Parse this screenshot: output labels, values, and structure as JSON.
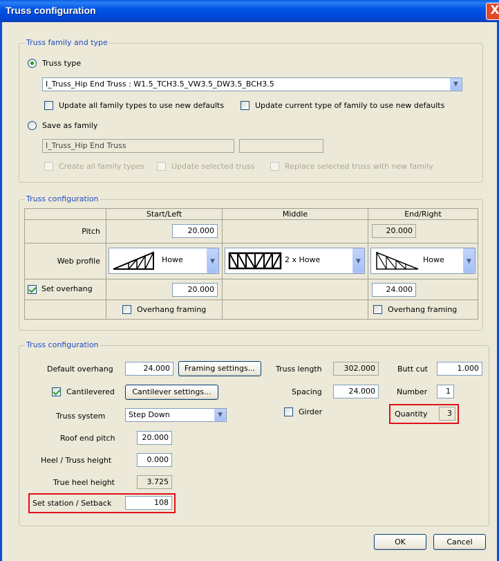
{
  "window": {
    "title": "Truss configuration",
    "close_glyph": "X"
  },
  "family_group": {
    "legend": "Truss family and type",
    "truss_type_label": "Truss type",
    "truss_type_selected": true,
    "truss_type_value": "I_Truss_Hip End Truss : W1.5_TCH3.5_VW3.5_DW3.5_BCH3.5",
    "update_all_label": "Update all family types to use new defaults",
    "update_current_label": "Update current type of family to use new defaults",
    "save_as_family_label": "Save as family",
    "family_name_value": "I_Truss_Hip End Truss",
    "family_type_value": "",
    "create_all_label": "Create all family types",
    "update_selected_label": "Update selected truss",
    "replace_selected_label": "Replace selected truss with new family"
  },
  "config_table": {
    "legend": "Truss configuration",
    "headers": [
      "Start/Left",
      "Middle",
      "End/Right"
    ],
    "pitch_label": "Pitch",
    "pitch_start": "20.000",
    "pitch_end": "20.000",
    "web_profile_label": "Web profile",
    "web_start": "Howe",
    "web_middle": "2 x Howe",
    "web_end": "Howe",
    "set_overhang_label": "Set overhang",
    "set_overhang_checked": true,
    "overhang_start": "20.000",
    "overhang_end": "24.000",
    "overhang_framing_label": "Overhang framing"
  },
  "settings": {
    "legend": "Truss configuration",
    "default_overhang_label": "Default overhang",
    "default_overhang_value": "24.000",
    "framing_settings_button": "Framing settings...",
    "cantilevered_label": "Cantilevered",
    "cantilevered_checked": true,
    "cantilever_settings_button": "Cantilever settings...",
    "truss_system_label": "Truss system",
    "truss_system_value": "Step Down",
    "roof_end_pitch_label": "Roof end pitch",
    "roof_end_pitch_value": "20.000",
    "heel_height_label": "Heel / Truss height",
    "heel_height_value": "0.000",
    "true_heel_label": "True heel height",
    "true_heel_value": "3.725",
    "setback_label": "Set station / Setback",
    "setback_value": "108",
    "truss_length_label": "Truss length",
    "truss_length_value": "302.000",
    "spacing_label": "Spacing",
    "spacing_value": "24.000",
    "girder_label": "Girder",
    "butt_cut_label": "Butt cut",
    "butt_cut_value": "1.000",
    "number_label": "Number",
    "number_value": "1",
    "quantity_label": "Quantity",
    "quantity_value": "3"
  },
  "footer": {
    "ok_button": "OK",
    "cancel_button": "Cancel"
  },
  "colors": {
    "title_bar": "#0055e5",
    "legend_text": "#1f4bbf",
    "highlight": "#e0101a"
  },
  "icons": [
    "close-icon",
    "chevron-down-icon",
    "howe-truss-icon",
    "double-howe-truss-icon"
  ]
}
